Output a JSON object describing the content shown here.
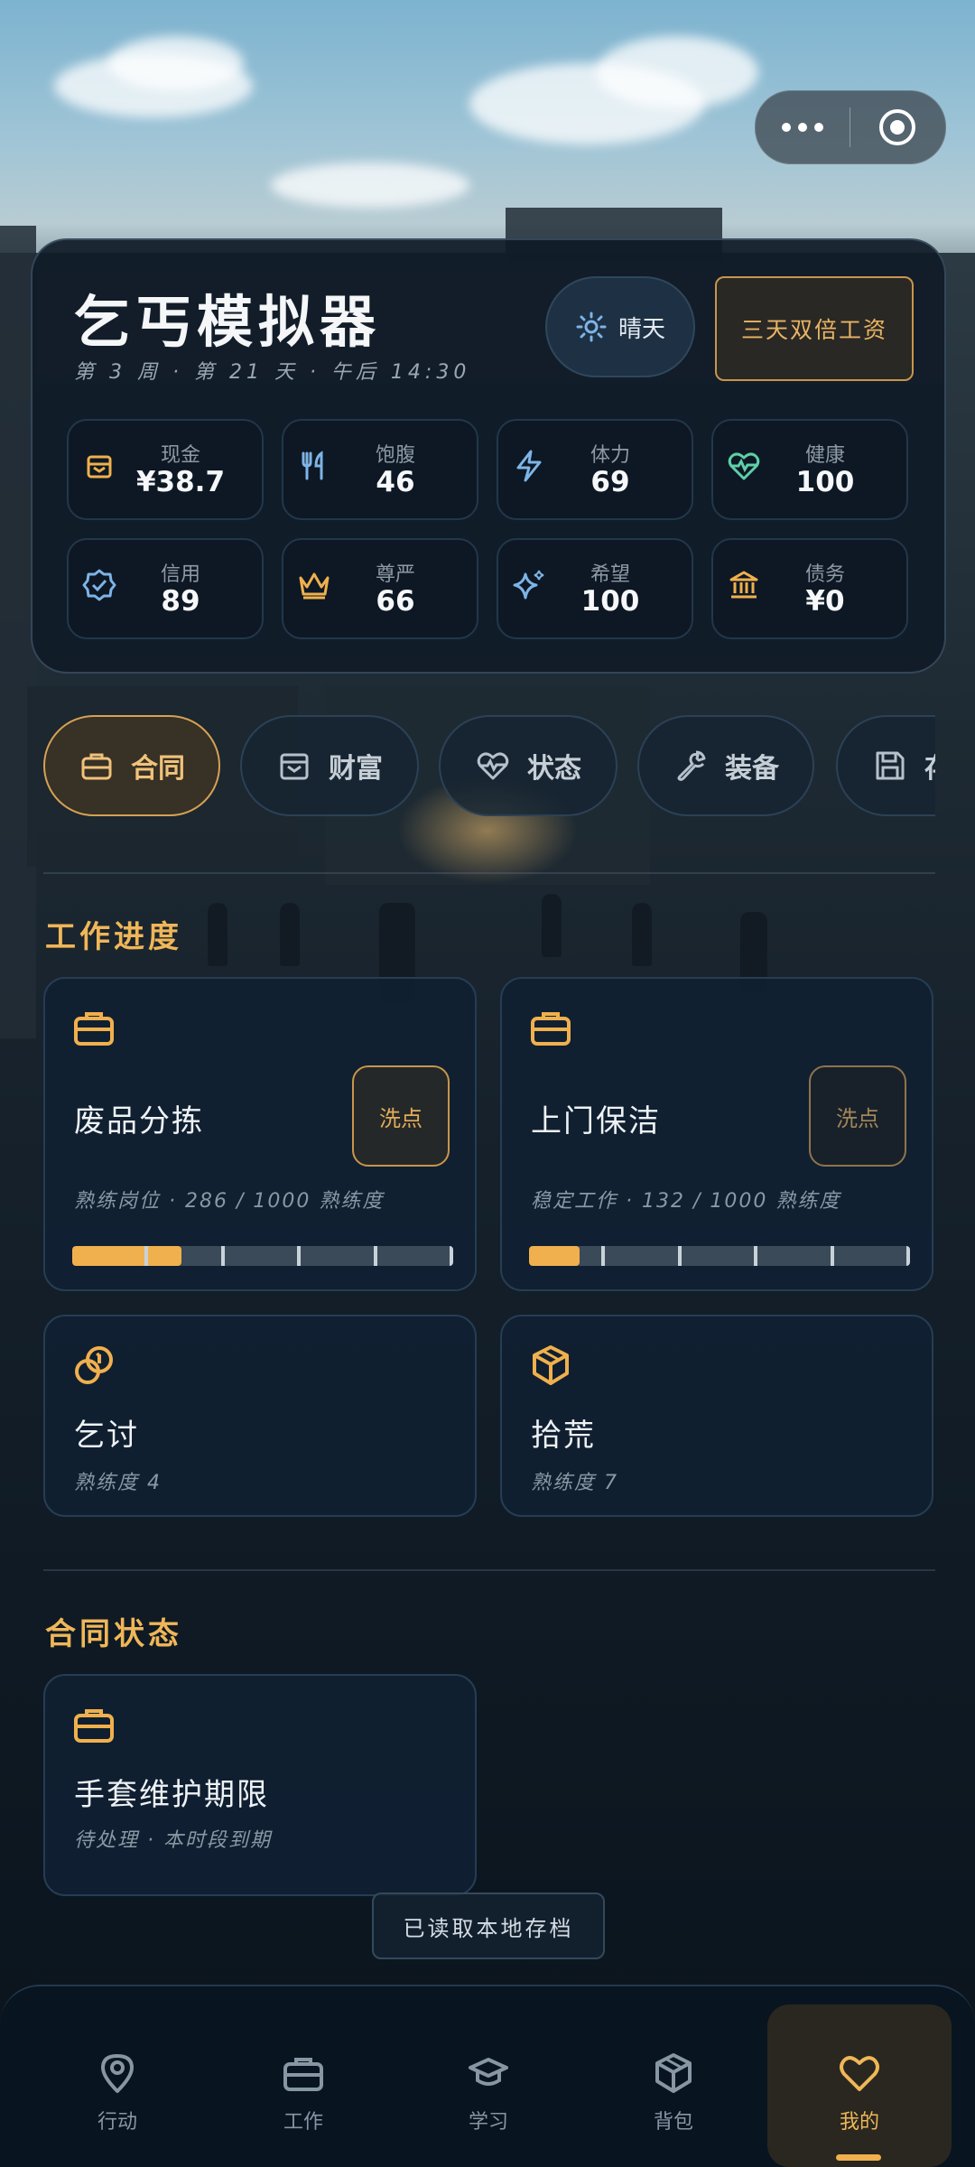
{
  "app": {
    "title": "乞丐模拟器",
    "subtitle": "第 3 周 · 第 21 天 · 午后 14:30",
    "weather": "晴天",
    "event_badge": "三天双倍工资"
  },
  "stats": [
    {
      "label": "现金",
      "value": "¥38.7",
      "icon": "wallet-icon",
      "color": "#f0b04d"
    },
    {
      "label": "饱腹",
      "value": "46",
      "icon": "utensils-icon",
      "color": "#7eb4e6"
    },
    {
      "label": "体力",
      "value": "69",
      "icon": "lightning-icon",
      "color": "#7eb4e6"
    },
    {
      "label": "健康",
      "value": "100",
      "icon": "heart-pulse-icon",
      "color": "#5ed0a8"
    },
    {
      "label": "信用",
      "value": "89",
      "icon": "verified-badge-icon",
      "color": "#7eb4e6"
    },
    {
      "label": "尊严",
      "value": "66",
      "icon": "crown-icon",
      "color": "#f0b04d"
    },
    {
      "label": "希望",
      "value": "100",
      "icon": "sparkles-icon",
      "color": "#7eb4e6"
    },
    {
      "label": "债务",
      "value": "¥0",
      "icon": "bank-icon",
      "color": "#f0b04d"
    }
  ],
  "tabs": [
    {
      "label": "合同",
      "icon": "briefcase-icon",
      "active": true
    },
    {
      "label": "财富",
      "icon": "wallet-icon",
      "active": false
    },
    {
      "label": "状态",
      "icon": "heart-pulse-icon",
      "active": false
    },
    {
      "label": "装备",
      "icon": "wrench-icon",
      "active": false
    },
    {
      "label": "存",
      "icon": "save-icon",
      "active": false
    }
  ],
  "work_section": {
    "title": "工作进度",
    "jobs": [
      {
        "name": "废品分拣",
        "meta": "熟练岗位 · 286 / 1000 熟练度",
        "button": "洗点",
        "progress": 0.286
      },
      {
        "name": "上门保洁",
        "meta": "稳定工作 · 132 / 1000 熟练度",
        "button": "洗点",
        "progress": 0.132
      },
      {
        "name": "乞讨",
        "meta": "熟练度 4"
      },
      {
        "name": "拾荒",
        "meta": "熟练度 7"
      }
    ]
  },
  "contract_section": {
    "title": "合同状态",
    "items": [
      {
        "name": "手套维护期限",
        "meta": "待处理 · 本时段到期"
      }
    ]
  },
  "toast": "已读取本地存档",
  "nav": [
    {
      "label": "行动",
      "icon": "map-pin-icon"
    },
    {
      "label": "工作",
      "icon": "briefcase-icon"
    },
    {
      "label": "学习",
      "icon": "graduation-cap-icon"
    },
    {
      "label": "背包",
      "icon": "package-icon"
    },
    {
      "label": "我的",
      "icon": "heart-icon",
      "active": true
    }
  ],
  "colors": {
    "accent": "#f0b04d",
    "panel": "#101b28",
    "blue_icon": "#7eb4e6",
    "green_icon": "#5ed0a8"
  }
}
